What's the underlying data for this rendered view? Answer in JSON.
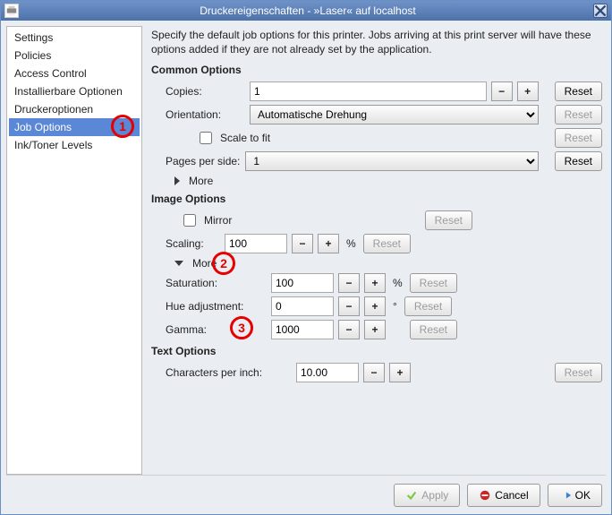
{
  "window": {
    "title": "Druckereigenschaften - »Laser« auf localhost"
  },
  "sidebar": {
    "items": [
      {
        "label": "Settings"
      },
      {
        "label": "Policies"
      },
      {
        "label": "Access Control"
      },
      {
        "label": "Installierbare Optionen"
      },
      {
        "label": "Druckeroptionen"
      },
      {
        "label": "Job Options"
      },
      {
        "label": "Ink/Toner Levels"
      }
    ]
  },
  "main": {
    "description": "Specify the default job options for this printer.  Jobs arriving at this print server will have these options added if they are not already set by the application.",
    "reset_label": "Reset",
    "more_label": "More",
    "common": {
      "heading": "Common Options",
      "copies_label": "Copies:",
      "copies_value": "1",
      "orientation_label": "Orientation:",
      "orientation_value": "Automatische Drehung",
      "scale_to_fit_label": "Scale to fit",
      "pages_per_side_label": "Pages per side:",
      "pages_per_side_value": "1"
    },
    "image": {
      "heading": "Image Options",
      "mirror_label": "Mirror",
      "scaling_label": "Scaling:",
      "scaling_value": "100",
      "saturation_label": "Saturation:",
      "saturation_value": "100",
      "hue_label": "Hue adjustment:",
      "hue_value": "0",
      "gamma_label": "Gamma:",
      "gamma_value": "1000",
      "percent": "%",
      "degree": "°"
    },
    "text": {
      "heading": "Text Options",
      "cpi_label": "Characters per inch:",
      "cpi_value": "10.00"
    }
  },
  "buttons": {
    "apply": "Apply",
    "cancel": "Cancel",
    "ok": "OK"
  },
  "annotations": {
    "n1": "1",
    "n2": "2",
    "n3": "3"
  }
}
